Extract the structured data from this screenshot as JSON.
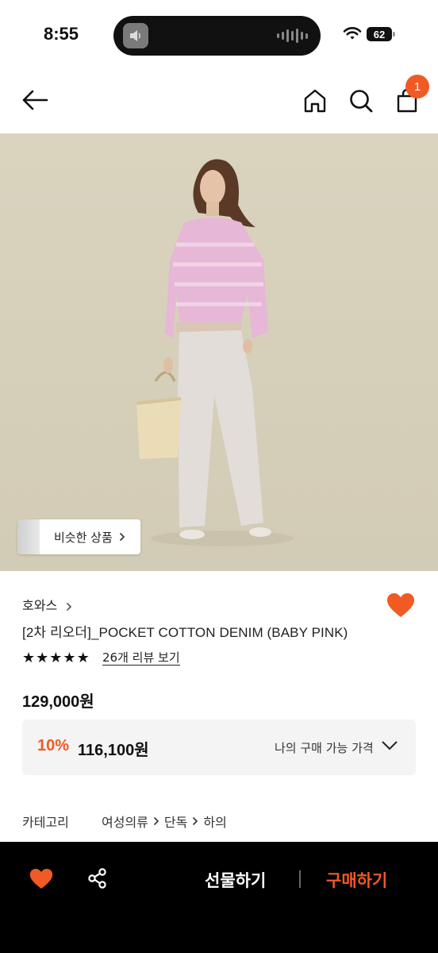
{
  "status_bar": {
    "time": "8:55",
    "battery": "62"
  },
  "nav": {
    "cart_count": "1",
    "icons": [
      "back-arrow-icon",
      "home-icon",
      "search-icon",
      "shopping-bag-icon"
    ]
  },
  "product": {
    "similar_button_label": "비슷한 상품",
    "brand": "호와스",
    "name": "[2차 리오더]_POCKET COTTON DENIM (BABY PINK)",
    "rating_stars": 5,
    "review_link": "26개 리뷰 보기",
    "price": "129,000원",
    "my_price": {
      "discount_rate": "10%",
      "discounted_price": "116,100원",
      "label": "나의 구매 가능 가격"
    },
    "category": {
      "label": "카테고리",
      "path": [
        "여성의류",
        "단독",
        "하의"
      ]
    }
  },
  "bottom_bar": {
    "gift_label": "선물하기",
    "buy_label": "구매하기"
  },
  "colors": {
    "accent": "#f15a24",
    "bottom_bar_bg": "#000000",
    "price_box_bg": "#f4f4f4"
  }
}
